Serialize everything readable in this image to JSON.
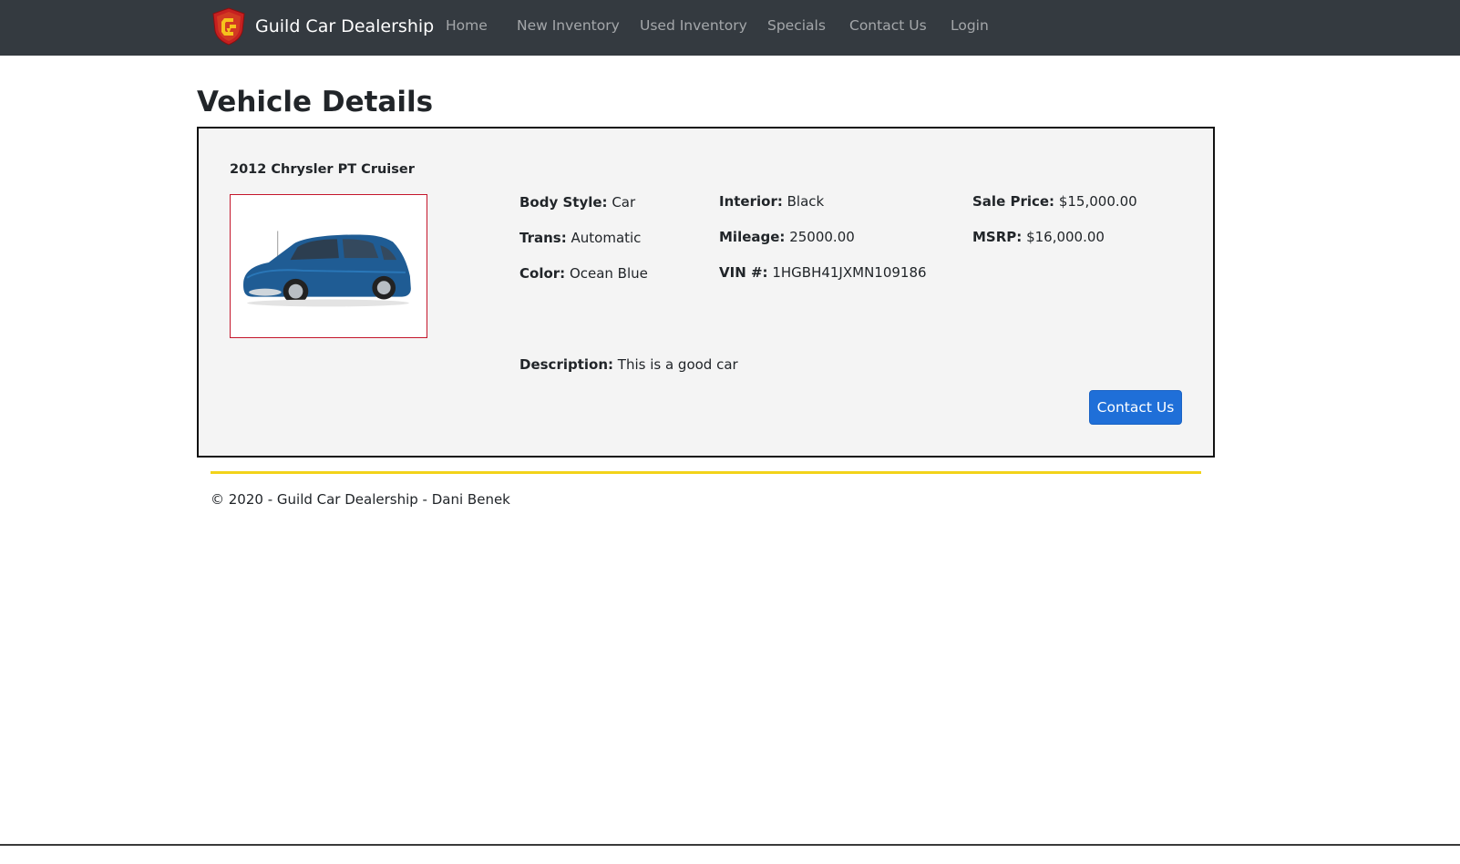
{
  "navbar": {
    "brand": "Guild Car Dealership",
    "links": [
      "Home",
      "New Inventory",
      "Used Inventory",
      "Specials",
      "Contact Us",
      "Login"
    ]
  },
  "page": {
    "title": "Vehicle Details"
  },
  "vehicle": {
    "title": "2012 Chrysler PT Cruiser",
    "photo_icon": "car-photo",
    "specs": {
      "body_style": {
        "label": "Body Style:",
        "value": "Car"
      },
      "trans": {
        "label": "Trans:",
        "value": "Automatic"
      },
      "color": {
        "label": "Color:",
        "value": "Ocean Blue"
      },
      "interior": {
        "label": "Interior:",
        "value": "Black"
      },
      "mileage": {
        "label": "Mileage:",
        "value": "25000.00"
      },
      "vin": {
        "label": "VIN #:",
        "value": "1HGBH41JXMN109186"
      },
      "sale_price": {
        "label": "Sale Price:",
        "value": "$15,000.00"
      },
      "msrp": {
        "label": "MSRP:",
        "value": "$16,000.00"
      }
    },
    "description": {
      "label": "Description:",
      "value": "This is a good car"
    },
    "contact_button": "Contact Us"
  },
  "footer": {
    "text": "© 2020 - Guild Car Dealership - Dani Benek"
  },
  "colors": {
    "navbar_bg": "#343a40",
    "button": "#1f6fd8",
    "footer_rule": "#f2d31a",
    "photo_border": "#c4162b"
  }
}
